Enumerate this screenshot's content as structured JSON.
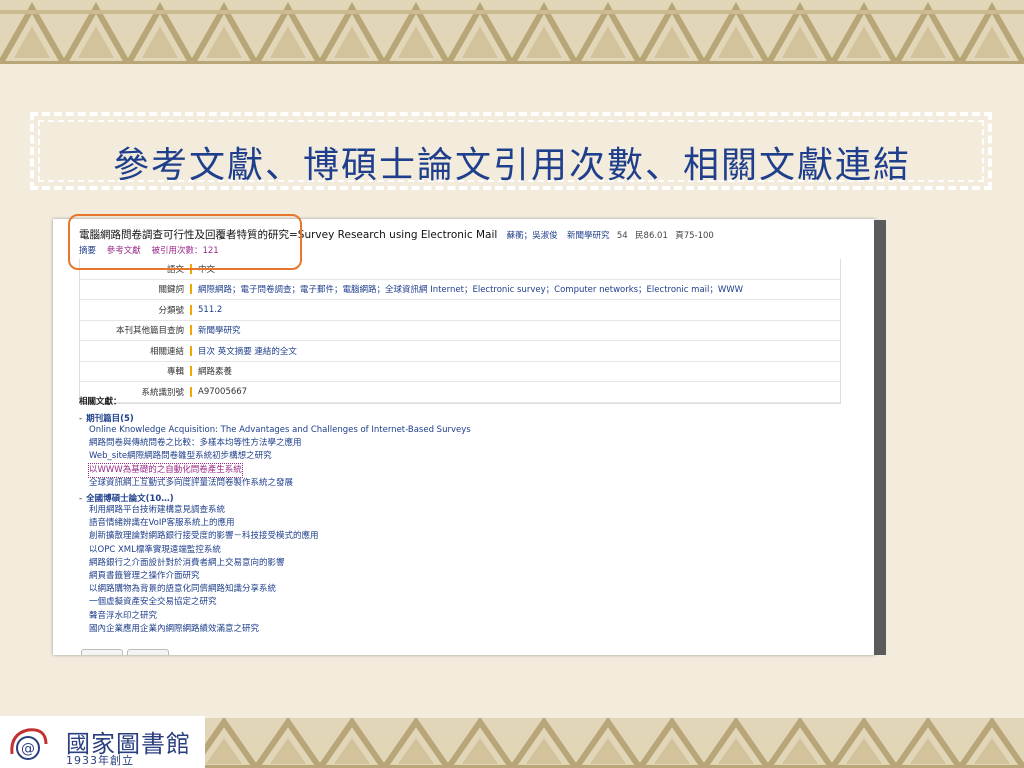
{
  "slide": {
    "title": "參考文獻、博碩士論文引用次數、相關文獻連結"
  },
  "record": {
    "title": "電腦網路問卷調查可行性及回覆者特質的研究=Survey Research using Electronic Mail",
    "author": "蘇蘅；吳淑俊",
    "journal": "新聞學研究",
    "volume": "54",
    "date": "民86.01",
    "pages": "頁75-100"
  },
  "tabs": {
    "abstract": "摘要",
    "references": "參考文獻",
    "cited": "被引用次數：121"
  },
  "details": [
    {
      "key": "語文",
      "value": "中文",
      "link": false
    },
    {
      "key": "關鍵詞",
      "value": "網際網路；電子問卷調查；電子郵件；電腦網路；全球資訊網 Internet；Electronic survey；Computer networks；Electronic mail；WWW",
      "link": true
    },
    {
      "key": "分類號",
      "value": "511.2",
      "link": true
    },
    {
      "key": "本刊其他篇目查詢",
      "value": "新聞學研究",
      "link": true
    },
    {
      "key": "相關連結",
      "value": "目次 英文摘要 連結的全文",
      "link": true
    },
    {
      "key": "專輯",
      "value": "網路素養",
      "link": false
    },
    {
      "key": "系統識別號",
      "value": "A97005667",
      "link": false
    }
  ],
  "related": {
    "heading": "相關文獻：",
    "journal_group": "期刊篇目(5)",
    "journal_items": [
      "Online Knowledge Acquisition: The Advantages and Challenges of Internet-Based Surveys",
      "網路問卷與傳統問卷之比較：多樣本均等性方法學之應用",
      "Web_site網際網路問卷雛型系統初步構想之研究",
      "以WWW為基礎的之自動化問卷產生系統",
      "全球資訊網上互動式多向度評量法問卷製作系統之發展"
    ],
    "selected_index": 3,
    "thesis_group": "全國博碩士論文(10…)",
    "thesis_items": [
      "利用網路平台技術建構意見調查系統",
      "語音情緒辨識在VoIP客服系統上的應用",
      "創新擴散理論對網路銀行接受度的影響－科技接受模式的應用",
      "以OPC XML標準實現遠端監控系統",
      "網路銀行之介面設計對於消費者網上交易意向的影響",
      "網頁書籤管理之操作介面研究",
      "以網路購物為背景的語意化同儕網路知識分享系統",
      "一個虛擬資產安全交易協定之研究",
      "聲音浮水印之研究",
      "國內企業應用企業內網際網路績效滿意之研究"
    ]
  },
  "logo": {
    "name": "國家圖書館",
    "year": "1933年創立"
  },
  "colors": {
    "title": "#1f3f8c",
    "highlight": "#e7772a",
    "link": "#1f3f8c"
  }
}
